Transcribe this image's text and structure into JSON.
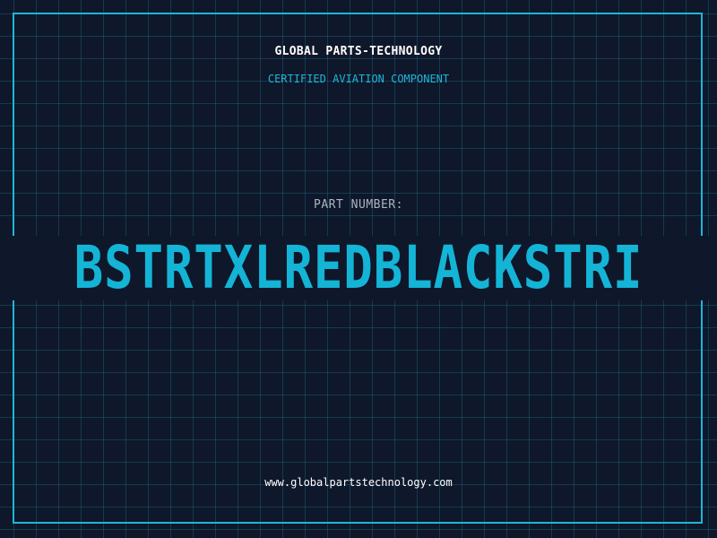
{
  "header": {
    "company": "GLOBAL PARTS-TECHNOLOGY",
    "subtitle": "CERTIFIED AVIATION COMPONENT"
  },
  "part": {
    "label": "PART NUMBER:",
    "number": "BSTRTXLREDBLACKSTRI"
  },
  "footer": {
    "website": "www.globalpartstechnology.com"
  },
  "colors": {
    "background": "#0f172a",
    "accent": "#1fb6d6",
    "grid": "#22829f",
    "label": "#aab4c3"
  }
}
